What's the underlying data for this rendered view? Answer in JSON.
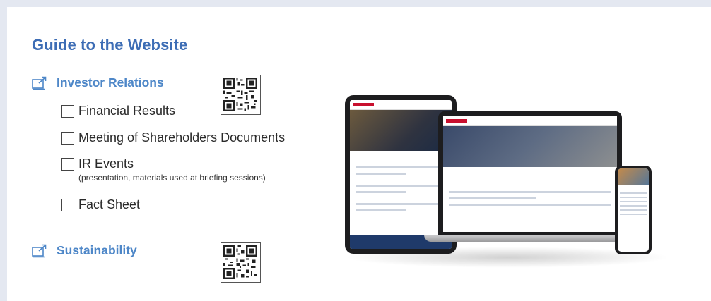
{
  "guide": {
    "title": "Guide to the Website"
  },
  "investor_relations": {
    "heading": "Investor Relations",
    "items": [
      {
        "label": "Financial Results"
      },
      {
        "label": "Meeting of Shareholders Documents"
      },
      {
        "label": "IR Events",
        "sub": "(presentation, materials used at briefing sessions)"
      },
      {
        "label": "Fact Sheet"
      }
    ]
  },
  "sustainability": {
    "heading": "Sustainability"
  },
  "icons": {
    "section_icon": "external-link-icon",
    "qr": "qr-code-icon"
  },
  "colors": {
    "title": "#3d6db5",
    "section_heading": "#4e87c8",
    "frame": "#e4e8f1"
  }
}
